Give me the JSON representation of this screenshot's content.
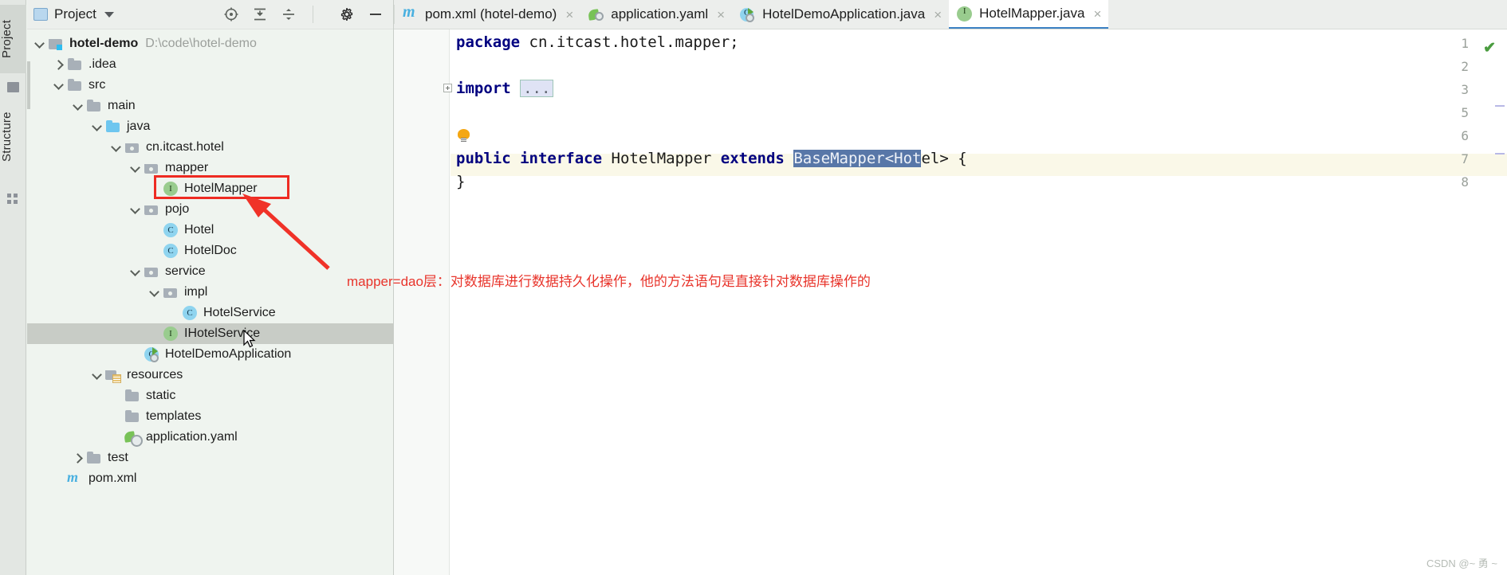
{
  "toolwindows": {
    "left_tabs": [
      {
        "label": "Project",
        "selected": true,
        "icon": "project-icon"
      },
      {
        "label": "Structure",
        "selected": false,
        "icon": "structure-icon"
      }
    ]
  },
  "project_panel": {
    "title": "Project",
    "title_icon": "project-view-icon",
    "dropdown_icon": "chevron-down-icon",
    "toolbar": [
      {
        "name": "select-opened-file-icon",
        "tooltip": "Select Opened File"
      },
      {
        "name": "expand-all-icon",
        "tooltip": "Expand All"
      },
      {
        "name": "collapse-all-icon",
        "tooltip": "Collapse All"
      },
      {
        "name": "settings-gear-icon",
        "tooltip": "Settings"
      },
      {
        "name": "hide-icon",
        "tooltip": "Hide"
      }
    ],
    "tree": [
      {
        "label": "hotel-demo",
        "path": "D:\\code\\hotel-demo",
        "indent": 0,
        "arrow": "down",
        "icon": "module",
        "bold": true,
        "selected": false,
        "boxed": false
      },
      {
        "label": ".idea",
        "path": "",
        "indent": 1,
        "arrow": "right",
        "icon": "folder",
        "bold": false,
        "selected": false,
        "boxed": false
      },
      {
        "label": "src",
        "path": "",
        "indent": 1,
        "arrow": "down",
        "icon": "folder",
        "bold": false,
        "selected": false,
        "boxed": false
      },
      {
        "label": "main",
        "path": "",
        "indent": 2,
        "arrow": "down",
        "icon": "folder",
        "bold": false,
        "selected": false,
        "boxed": false
      },
      {
        "label": "java",
        "path": "",
        "indent": 3,
        "arrow": "down",
        "icon": "srcfolder",
        "bold": false,
        "selected": false,
        "boxed": false
      },
      {
        "label": "cn.itcast.hotel",
        "path": "",
        "indent": 4,
        "arrow": "down",
        "icon": "pkg",
        "bold": false,
        "selected": false,
        "boxed": false
      },
      {
        "label": "mapper",
        "path": "",
        "indent": 5,
        "arrow": "down",
        "icon": "pkg",
        "bold": false,
        "selected": false,
        "boxed": false
      },
      {
        "label": "HotelMapper",
        "path": "",
        "indent": 6,
        "arrow": "none",
        "icon": "iface",
        "bold": false,
        "selected": false,
        "boxed": true
      },
      {
        "label": "pojo",
        "path": "",
        "indent": 5,
        "arrow": "down",
        "icon": "pkg",
        "bold": false,
        "selected": false,
        "boxed": false
      },
      {
        "label": "Hotel",
        "path": "",
        "indent": 6,
        "arrow": "none",
        "icon": "cls",
        "bold": false,
        "selected": false,
        "boxed": false
      },
      {
        "label": "HotelDoc",
        "path": "",
        "indent": 6,
        "arrow": "none",
        "icon": "cls",
        "bold": false,
        "selected": false,
        "boxed": false
      },
      {
        "label": "service",
        "path": "",
        "indent": 5,
        "arrow": "down",
        "icon": "pkg",
        "bold": false,
        "selected": false,
        "boxed": false
      },
      {
        "label": "impl",
        "path": "",
        "indent": 6,
        "arrow": "down",
        "icon": "pkg",
        "bold": false,
        "selected": false,
        "boxed": false
      },
      {
        "label": "HotelService",
        "path": "",
        "indent": 7,
        "arrow": "none",
        "icon": "cls",
        "bold": false,
        "selected": false,
        "boxed": false
      },
      {
        "label": "IHotelService",
        "path": "",
        "indent": 6,
        "arrow": "none",
        "icon": "iface",
        "bold": false,
        "selected": true,
        "boxed": false
      },
      {
        "label": "HotelDemoApplication",
        "path": "",
        "indent": 5,
        "arrow": "none",
        "icon": "springcls",
        "bold": false,
        "selected": false,
        "boxed": false
      },
      {
        "label": "resources",
        "path": "",
        "indent": 3,
        "arrow": "down",
        "icon": "resfolder",
        "bold": false,
        "selected": false,
        "boxed": false
      },
      {
        "label": "static",
        "path": "",
        "indent": 4,
        "arrow": "none",
        "icon": "folder",
        "bold": false,
        "selected": false,
        "boxed": false
      },
      {
        "label": "templates",
        "path": "",
        "indent": 4,
        "arrow": "none",
        "icon": "folder",
        "bold": false,
        "selected": false,
        "boxed": false
      },
      {
        "label": "application.yaml",
        "path": "",
        "indent": 4,
        "arrow": "none",
        "icon": "yaml",
        "bold": false,
        "selected": false,
        "boxed": false
      },
      {
        "label": "test",
        "path": "",
        "indent": 2,
        "arrow": "right",
        "icon": "folder",
        "bold": false,
        "selected": false,
        "boxed": false
      },
      {
        "label": "pom.xml",
        "path": "",
        "indent": 1,
        "arrow": "none",
        "icon": "maven",
        "bold": false,
        "selected": false,
        "boxed": false
      }
    ]
  },
  "editor": {
    "tabs": [
      {
        "label": "pom.xml (hotel-demo)",
        "icon": "maven-icon",
        "active": false,
        "closable": true
      },
      {
        "label": "application.yaml",
        "icon": "spring-yaml-icon",
        "active": false,
        "closable": true
      },
      {
        "label": "HotelDemoApplication.java",
        "icon": "spring-class-icon",
        "active": false,
        "closable": true
      },
      {
        "label": "HotelMapper.java",
        "icon": "interface-icon",
        "active": true,
        "closable": true
      }
    ],
    "gutter_line_numbers": [
      "1",
      "2",
      "3",
      "5",
      "6",
      "7",
      "8"
    ],
    "code": {
      "line1_kw": "package",
      "line1_rest": " cn.itcast.hotel.mapper;",
      "line3_kw": "import",
      "line3_fold": "...",
      "line6_kw1": "public",
      "line6_kw2": "interface",
      "line6_name": "HotelMapper",
      "line6_kw3": "extends",
      "line6_selected": "BaseMapper<Hot",
      "line6_tail": "el> {",
      "line7": "}"
    },
    "inspection_status": "✔",
    "intention_bulb": "lightbulb-icon"
  },
  "annotations": {
    "note_text": "mapper=dao层：对数据库进行数据持久化操作，他的方法语句是直接针对数据库操作的",
    "note_color": "#e8342b",
    "highlight_box_color": "#ee2b22",
    "arrow_color": "#f03228"
  },
  "watermark": {
    "text": "CSDN @~ 勇 ~"
  }
}
